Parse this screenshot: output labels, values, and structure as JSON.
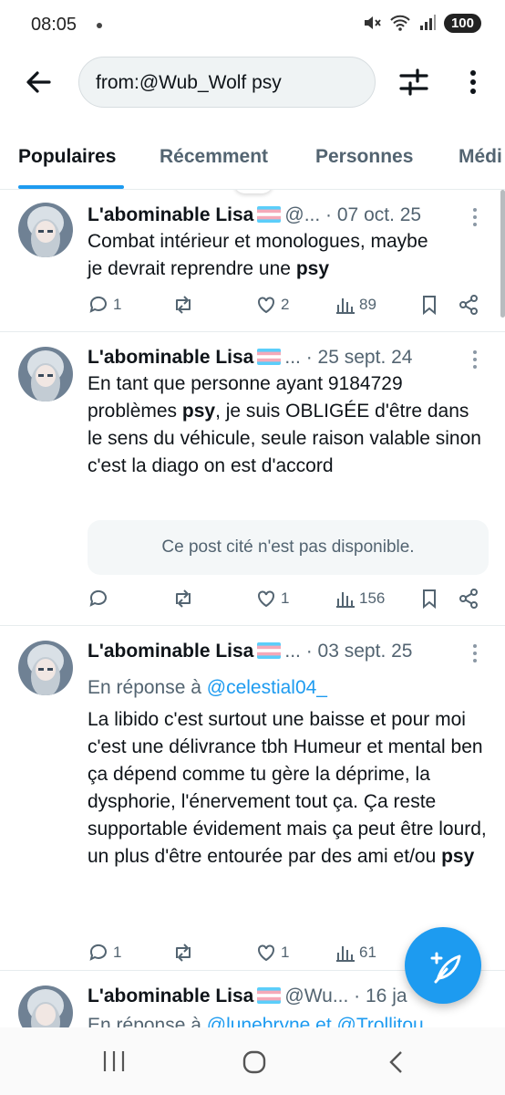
{
  "status": {
    "time": "08:05",
    "battery": "100"
  },
  "search": {
    "query": "from:@Wub_Wolf psy"
  },
  "tabs": [
    "Populaires",
    "Récemment",
    "Personnes",
    "Médi"
  ],
  "posts": [
    {
      "name": "L'abominable Lisa",
      "handle": "@...",
      "date": "· 07 oct. 25",
      "text_lines": [
        "Combat intérieur et monologues, maybe",
        "je devrait reprendre une "
      ],
      "bold_word": "psy",
      "replies": "1",
      "reposts": "",
      "likes": "2",
      "views": "89"
    },
    {
      "name": "L'abominable Lisa",
      "handle": "...",
      "date": "· 25 sept. 24",
      "text_a": "En tant que personne ayant 9184729 problèmes ",
      "bold_word": "psy",
      "text_b": ", je suis OBLIGÉE d'être dans le sens du véhicule, seule raison valable sinon c'est la diago on est d'accord",
      "quote": "Ce post cité n'est pas disponible.",
      "replies": "",
      "reposts": "",
      "likes": "1",
      "views": "156"
    },
    {
      "name": "L'abominable Lisa",
      "handle": "...",
      "date": "· 03 sept. 25",
      "reply_prefix": "En réponse à ",
      "reply_mention": "@celestial04_",
      "text_a": "La libido c'est surtout une baisse et pour moi c'est une délivrance tbh Humeur et mental ben ça dépend comme tu gère la déprime, la dysphorie, l'énervement tout ça. Ça reste supportable évidement mais ça peut être lourd, un plus d'être entourée par des ami et/ou ",
      "bold_word": "psy",
      "replies": "1",
      "reposts": "",
      "likes": "1",
      "views": "61"
    },
    {
      "name": "L'abominable Lisa",
      "handle": "@Wu...",
      "date": "· 16 ja",
      "reply_prefix": "En réponse à ",
      "reply_mention": "@lunebryne et @Trollitou"
    }
  ],
  "colors": {
    "accent": "#1d9bf0",
    "text": "#0f1419",
    "muted": "#536471"
  }
}
